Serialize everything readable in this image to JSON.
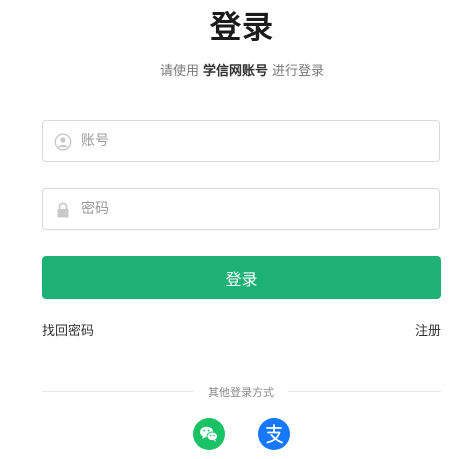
{
  "header": {
    "title": "登录",
    "subtitle_prefix": "请使用",
    "subtitle_brand": "学信网账号",
    "subtitle_suffix": "进行登录"
  },
  "form": {
    "account_placeholder": "账号",
    "password_placeholder": "密码",
    "account_icon": "user-icon",
    "password_icon": "lock-icon",
    "login_label": "登录"
  },
  "links": {
    "forgot": "找回密码",
    "register": "注册"
  },
  "other_login": {
    "label": "其他登录方式",
    "methods": [
      {
        "name": "wechat",
        "icon": "wechat-icon",
        "color": "#18c265"
      },
      {
        "name": "alipay",
        "icon": "alipay-icon",
        "color": "#1677ff"
      }
    ]
  },
  "colors": {
    "primary": "#1db176",
    "wechat": "#18c265",
    "alipay": "#1677ff"
  }
}
